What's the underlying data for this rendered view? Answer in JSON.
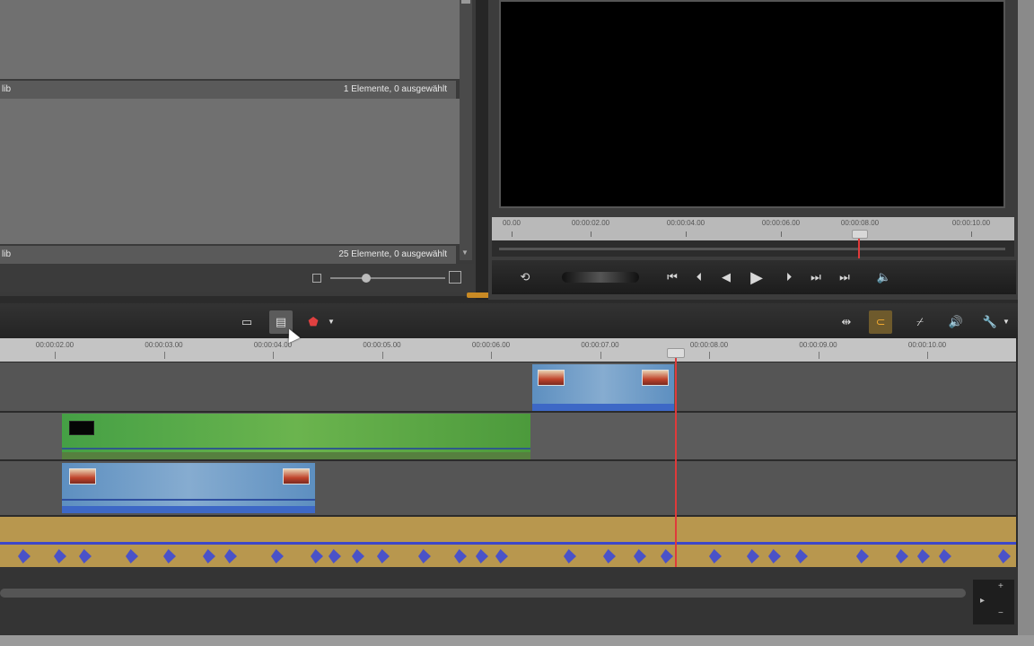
{
  "library": {
    "status_top": {
      "label": "lib",
      "count": "1 Elemente, 0 ausgewählt"
    },
    "status_bottom": {
      "label": "lib",
      "count": "25 Elemente, 0 ausgewählt"
    },
    "zoom_level": 0.3
  },
  "player": {
    "ruler_ticks": [
      "00.00",
      "00:00:02.00",
      "00:00:04.00",
      "00:00:06.00",
      "00:00:08.00",
      "00:00:10.00"
    ],
    "transport": {
      "loop_icon": "loop-icon",
      "jog_icon": "jog-shuttle",
      "buttons": [
        "skip-to-start-icon",
        "step-back-icon",
        "rewind-icon",
        "play-icon",
        "fast-forward-icon",
        "step-forward-icon",
        "skip-to-end-icon"
      ],
      "volume_icon": "volume-icon"
    }
  },
  "timeline": {
    "toolbar": {
      "left_tools": [
        "storyboard-icon",
        "timeline-view-icon",
        "marker-icon"
      ],
      "right_tools": [
        "trim-icon",
        "magnet-icon",
        "keyframe-icon",
        "audio-icon",
        "tools-icon"
      ]
    },
    "ruler_ticks": [
      "00:00:02.00",
      "00:00:03.00",
      "00:00:04.00",
      "00:00:05.00",
      "00:00:06.00",
      "00:00:07.00",
      "00:00:08.00",
      "00:00:09.00",
      "00:00:10.00"
    ]
  },
  "colors": {
    "playhead": "#e03a3a",
    "video_clip": "#6f9fcc",
    "title_clip": "#5aaa4a",
    "audio_clip": "#b8974e",
    "waveform": "#3d47c9",
    "magnet_active": "#f0a830"
  }
}
